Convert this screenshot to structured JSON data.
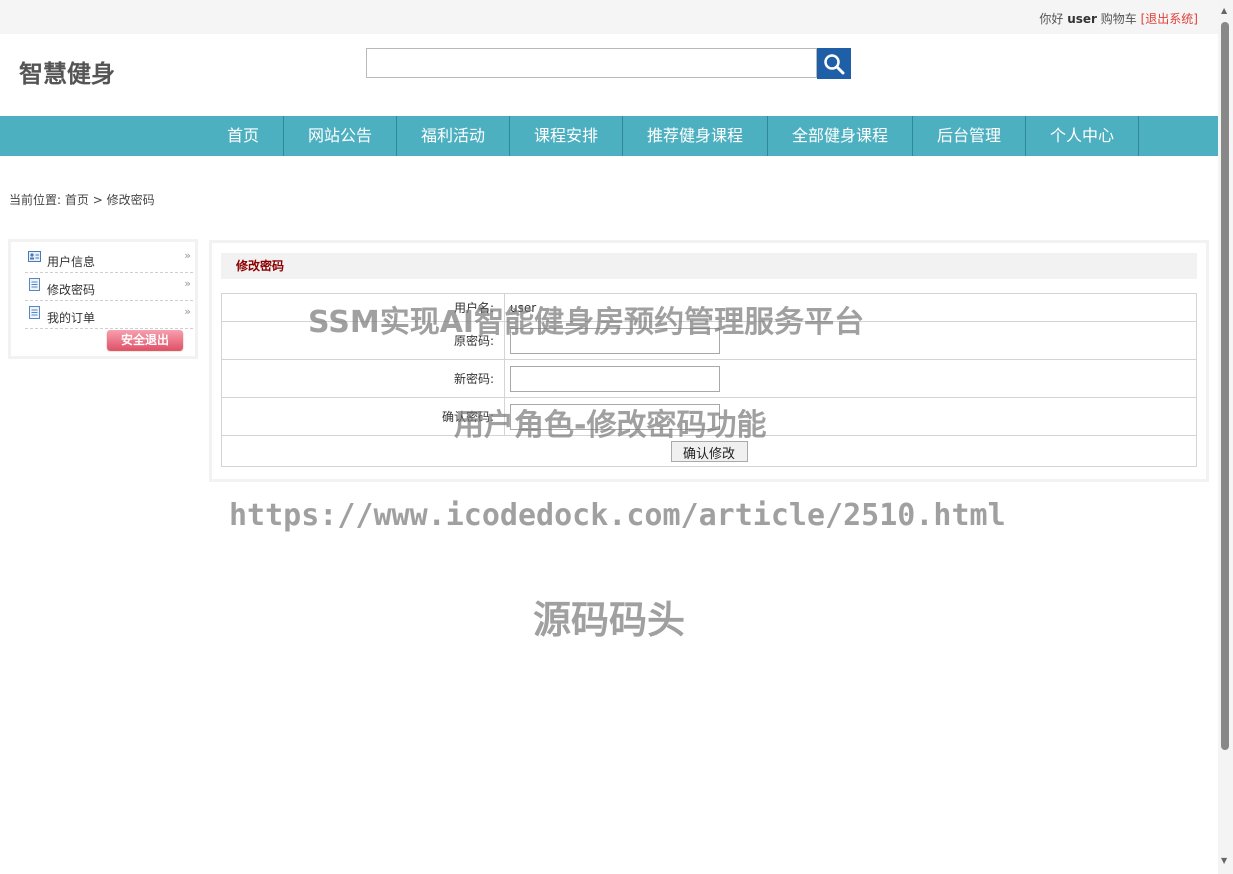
{
  "topbar": {
    "greeting": "你好",
    "username": "user",
    "cart": "购物车",
    "logout": "[退出系统]"
  },
  "header": {
    "site_title": "智慧健身",
    "search_value": ""
  },
  "nav": {
    "items": [
      "首页",
      "网站公告",
      "福利活动",
      "课程安排",
      "推荐健身课程",
      "全部健身课程",
      "后台管理",
      "个人中心"
    ]
  },
  "breadcrumb": {
    "prefix": "当前位置:",
    "home": "首页",
    "sep": ">",
    "current": "修改密码"
  },
  "sidebar": {
    "items": [
      {
        "label": "用户信息",
        "icon": "user-card-icon"
      },
      {
        "label": "修改密码",
        "icon": "document-icon"
      },
      {
        "label": "我的订单",
        "icon": "document-icon"
      }
    ],
    "exit_button": "安全退出"
  },
  "panel": {
    "title": "修改密码",
    "rows": {
      "username_label": "用户名:",
      "username_value": "user",
      "old_pw_label": "原密码:",
      "new_pw_label": "新密码:",
      "confirm_pw_label": "确认密码:"
    },
    "submit": "确认修改"
  },
  "watermarks": {
    "line1": "SSM实现AI智能健身房预约管理服务平台",
    "line2": "用户角色-修改密码功能",
    "line3": "https://www.icodedock.com/article/2510.html",
    "line4": "源码码头"
  },
  "colors": {
    "nav_bg": "#4db0c0",
    "search_button": "#1e5fa8",
    "panel_title": "#8b0000",
    "logout": "#e0413b"
  }
}
